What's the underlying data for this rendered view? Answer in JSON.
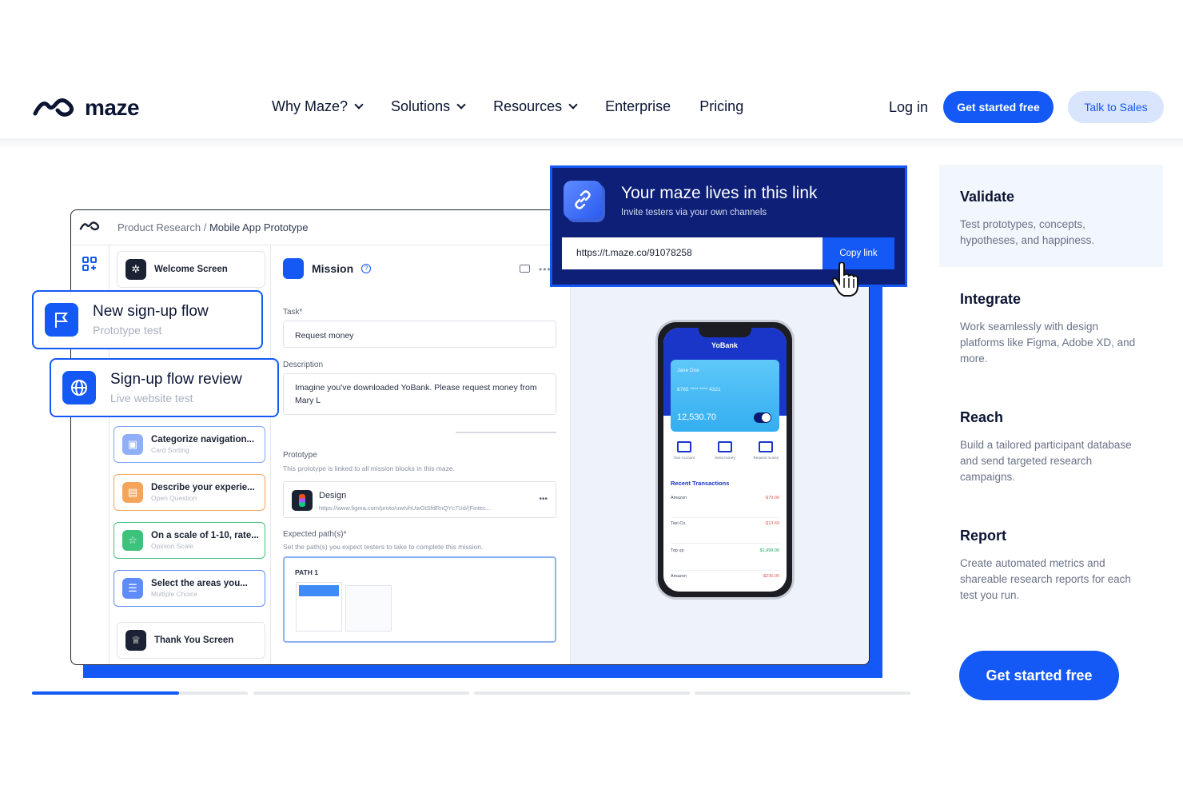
{
  "nav": {
    "brand": "maze",
    "menu": [
      "Why Maze?",
      "Solutions",
      "Resources",
      "Enterprise",
      "Pricing"
    ],
    "login": "Log in",
    "cta_primary": "Get started free",
    "cta_secondary": "Talk to Sales"
  },
  "app": {
    "breadcrumb_parent": "Product Research",
    "breadcrumb_sep": "/",
    "breadcrumb_current": "Mobile App Prototype",
    "blocks": [
      {
        "title": "Welcome Screen",
        "subtitle": ""
      },
      {
        "title": "Categorize navigation...",
        "subtitle": "Card Sorting"
      },
      {
        "title": "Describe your experie...",
        "subtitle": "Open Question"
      },
      {
        "title": "On a scale of 1-10, rate...",
        "subtitle": "Opinion Scale"
      },
      {
        "title": "Select the areas you...",
        "subtitle": "Multiple Choice"
      },
      {
        "title": "Thank You Screen",
        "subtitle": ""
      }
    ],
    "mission": {
      "title": "Mission",
      "task_label": "Task*",
      "task_value": "Request money",
      "description_label": "Description",
      "description_value": "Imagine you've downloaded YoBank. Please request money from Mary L",
      "prototype_label": "Prototype",
      "prototype_sub": "This prototype is linked to all mission blocks in this maze.",
      "design_title": "Design",
      "design_url": "https://www.figma.com/proto/uwIvhUwGtSfdRnQYc7Ud/(Fintec...",
      "paths_label": "Expected path(s)*",
      "paths_sub": "Set the path(s) you expect testers to take to complete this mission.",
      "path_name": "PATH 1"
    }
  },
  "floating_cards": [
    {
      "title": "New sign-up flow",
      "subtitle": "Prototype test"
    },
    {
      "title": "Sign-up flow review",
      "subtitle": "Live website test"
    }
  ],
  "link_panel": {
    "title": "Your maze lives in this link",
    "subtitle": "Invite testers via your own channels",
    "url": "https://t.maze.co/91078258",
    "copy_label": "Copy link"
  },
  "phone": {
    "brand": "YoBank",
    "card_name": "Jane Doe",
    "card_number": "8765 **** **** 4321",
    "balance": "12,530.70",
    "actions": [
      "Your Account",
      "Send money",
      "Request money"
    ],
    "recent_title": "Recent Transactions",
    "transactions": [
      {
        "name": "Amazon",
        "amount": "-$79.00",
        "positive": false
      },
      {
        "name": "Taxi Co.",
        "amount": "-$13.60",
        "positive": false
      },
      {
        "name": "Top up",
        "amount": "$1,999.00",
        "positive": true
      },
      {
        "name": "Amazon",
        "amount": "-$235.00",
        "positive": false
      }
    ]
  },
  "progress": {
    "active_index": 0,
    "fill_fraction": 0.68,
    "segments": 4
  },
  "features": [
    {
      "title": "Validate",
      "body": "Test prototypes, concepts, hypotheses, and happiness.",
      "active": true
    },
    {
      "title": "Integrate",
      "body": "Work seamlessly with design platforms like Figma, Adobe XD, and more.",
      "active": false
    },
    {
      "title": "Reach",
      "body": "Build a tailored participant database and send targeted research campaigns.",
      "active": false
    },
    {
      "title": "Report",
      "body": "Create automated metrics and shareable research reports for each test you run.",
      "active": false
    }
  ],
  "cta_bottom": "Get started free",
  "colors": {
    "brand_blue": "#1459f5",
    "navy": "#0d1f77",
    "text": "#0b1533"
  }
}
